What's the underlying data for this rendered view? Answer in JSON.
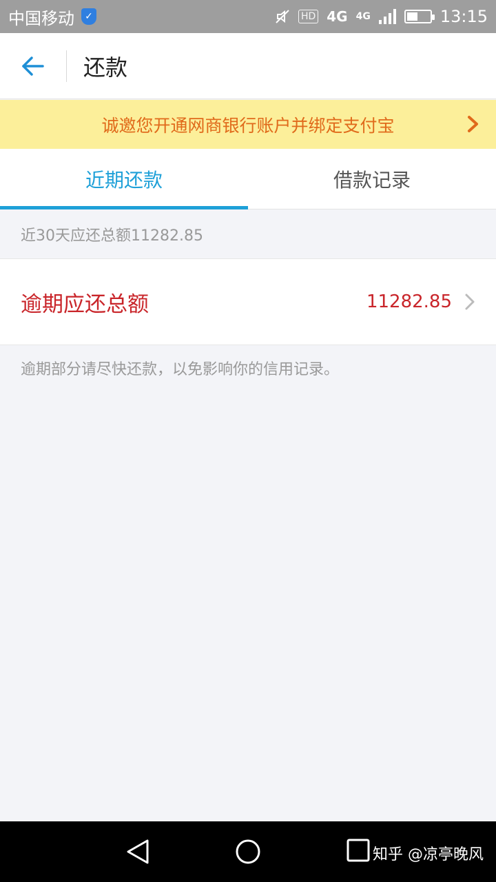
{
  "status_bar": {
    "carrier": "中国移动",
    "hd": "HD",
    "network": "4G",
    "network_small": "4G",
    "time": "13:15",
    "battery_level": 0.45
  },
  "header": {
    "title": "还款"
  },
  "banner": {
    "text": "诚邀您开通网商银行账户并绑定支付宝"
  },
  "tabs": [
    {
      "label": "近期还款",
      "active": true
    },
    {
      "label": "借款记录",
      "active": false
    }
  ],
  "summary": {
    "text": "近30天应还总额11282.85"
  },
  "overdue": {
    "label": "逾期应还总额",
    "amount": "11282.85"
  },
  "note": {
    "text": "逾期部分请尽快还款，以免影响你的信用记录。"
  },
  "watermark": {
    "text": "知乎 @凉亭晚风"
  },
  "colors": {
    "accent": "#1ea0d8",
    "overdue": "#c9252a",
    "banner_bg": "#fcef9a",
    "banner_text": "#e06a1b"
  }
}
